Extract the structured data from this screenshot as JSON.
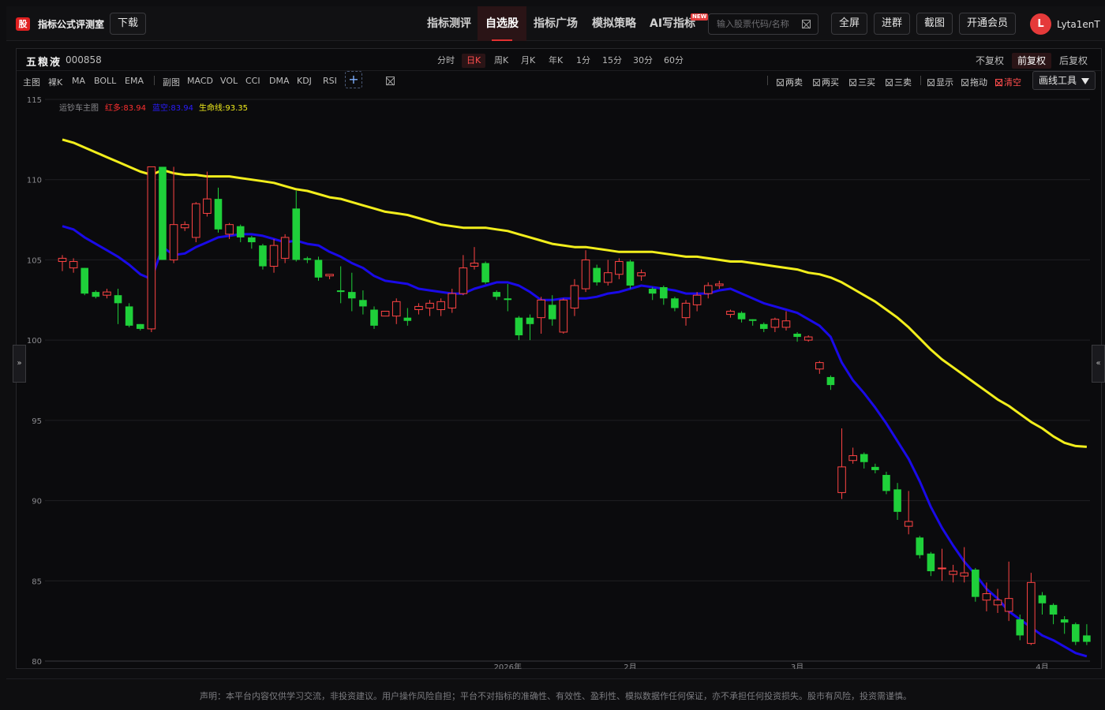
{
  "header": {
    "logo": "股",
    "app_title": "指标公式评测室",
    "download": "下载",
    "nav": [
      {
        "label": "指标测评",
        "active": false
      },
      {
        "label": "自选股",
        "active": true
      },
      {
        "label": "指标广场",
        "active": false
      },
      {
        "label": "模拟策略",
        "active": false
      },
      {
        "label": "AI写指标",
        "active": false
      }
    ],
    "new_badge": "NEW",
    "search_placeholder": "输入股票代码/名称",
    "buttons": [
      "全屏",
      "进群",
      "截图",
      "开通会员"
    ],
    "avatar": "L",
    "username": "Lyta1enT"
  },
  "stock": {
    "name": "五粮液",
    "code": "000858"
  },
  "periods": [
    {
      "label": "分时",
      "active": false
    },
    {
      "label": "日K",
      "active": true
    },
    {
      "label": "周K",
      "active": false
    },
    {
      "label": "月K",
      "active": false
    },
    {
      "label": "年K",
      "active": false
    },
    {
      "label": "1分",
      "active": false
    },
    {
      "label": "15分",
      "active": false
    },
    {
      "label": "30分",
      "active": false
    },
    {
      "label": "60分",
      "active": false
    }
  ],
  "adjust": [
    {
      "label": "不复权",
      "active": false
    },
    {
      "label": "前复权",
      "active": true
    },
    {
      "label": "后复权",
      "active": false
    }
  ],
  "main_tools": [
    "主图",
    "裸K",
    "MA",
    "BOLL",
    "EMA"
  ],
  "sub_tools": [
    "副图",
    "MACD",
    "VOL",
    "CCI",
    "DMA",
    "KDJ",
    "RSI"
  ],
  "plus": "+",
  "signals": [
    {
      "label": "两卖",
      "red": false
    },
    {
      "label": "两买",
      "red": false
    },
    {
      "label": "三买",
      "red": false
    },
    {
      "label": "三卖",
      "red": false
    },
    {
      "label": "显示",
      "red": false
    },
    {
      "label": "拖动",
      "red": false
    },
    {
      "label": "清空",
      "red": true
    }
  ],
  "draw_tools": "画线工具",
  "side_left": "»",
  "side_right": "«",
  "legend": {
    "title": "运钞车主图",
    "red": "红多:83.94",
    "blue": "蓝空:83.94",
    "yellow": "生命线:93.35"
  },
  "colors": {
    "up": "#ff4444",
    "down": "#1fd03a",
    "yellow": "#f2ee1c",
    "blue": "#1a0ae8"
  },
  "footer": "声明：本平台内容仅供学习交流，非投资建议。用户操作风险自担；平台不对指标的准确性、有效性、盈利性、模拟数据作任何保证，亦不承担任何投资损失。股市有风险，投资需谨慎。",
  "chart_data": {
    "type": "candlestick",
    "ylim": [
      80,
      115
    ],
    "yticks": [
      80,
      85,
      90,
      95,
      100,
      105,
      110,
      115
    ],
    "xticks": [
      {
        "index": 40,
        "label": "2026年"
      },
      {
        "index": 51,
        "label": "2月"
      },
      {
        "index": 66,
        "label": "3月"
      },
      {
        "index": 88,
        "label": "4月"
      }
    ],
    "candles": [
      [
        104.9,
        105.1,
        104.5,
        105.3,
        104.3
      ],
      [
        104.5,
        104.9,
        104.4,
        105.1,
        104.2
      ],
      [
        104.5,
        102.9,
        102.9,
        104.5,
        102.8
      ],
      [
        103.0,
        102.7,
        102.7,
        103.1,
        102.6
      ],
      [
        102.8,
        103.0,
        102.7,
        103.2,
        102.6
      ],
      [
        102.8,
        102.3,
        102.2,
        103.2,
        101.0
      ],
      [
        102.1,
        100.9,
        100.9,
        102.3,
        100.8
      ],
      [
        101.0,
        100.7,
        100.7,
        101.0,
        100.6
      ],
      [
        100.7,
        110.8,
        100.7,
        110.8,
        100.5
      ],
      [
        110.8,
        105.0,
        105.0,
        110.8,
        105.0
      ],
      [
        105.0,
        107.2,
        105.0,
        110.8,
        104.8
      ],
      [
        107.0,
        107.2,
        106.9,
        107.4,
        106.8
      ],
      [
        106.4,
        108.5,
        106.3,
        108.6,
        106.1
      ],
      [
        107.9,
        108.8,
        107.8,
        110.5,
        107.7
      ],
      [
        108.8,
        106.9,
        106.9,
        109.5,
        106.7
      ],
      [
        106.6,
        107.2,
        106.5,
        107.3,
        106.3
      ],
      [
        107.1,
        106.4,
        106.3,
        107.2,
        106.1
      ],
      [
        106.4,
        106.1,
        105.9,
        106.5,
        105.7
      ],
      [
        105.9,
        104.6,
        104.5,
        106.0,
        104.4
      ],
      [
        104.6,
        105.9,
        104.3,
        106.3,
        104.2
      ],
      [
        105.1,
        106.4,
        104.9,
        106.6,
        104.8
      ],
      [
        108.2,
        105.0,
        105.0,
        109.3,
        104.9
      ],
      [
        105.1,
        105.0,
        104.8,
        105.2,
        104.8
      ],
      [
        105.0,
        103.9,
        103.9,
        105.2,
        103.7
      ],
      [
        104.0,
        104.1,
        103.9,
        104.1,
        103.8
      ],
      [
        103.1,
        103.0,
        102.6,
        104.6,
        102.3
      ],
      [
        103.0,
        102.6,
        102.5,
        104.2,
        101.8
      ],
      [
        102.5,
        102.1,
        101.7,
        103.1,
        101.6
      ],
      [
        101.9,
        100.9,
        100.8,
        102.1,
        100.7
      ],
      [
        101.5,
        101.8,
        101.5,
        101.7,
        101.5
      ],
      [
        101.5,
        102.4,
        101.2,
        102.6,
        101.0
      ],
      [
        101.4,
        101.2,
        101.0,
        102.0,
        100.9
      ],
      [
        101.9,
        102.1,
        101.7,
        102.3,
        101.6
      ],
      [
        102.0,
        102.3,
        101.8,
        102.5,
        101.5
      ],
      [
        101.9,
        102.4,
        101.7,
        102.6,
        101.5
      ],
      [
        102.0,
        102.9,
        101.8,
        103.2,
        101.7
      ],
      [
        102.9,
        104.5,
        102.8,
        105.3,
        102.8
      ],
      [
        104.6,
        104.8,
        104.6,
        105.8,
        104.4
      ],
      [
        104.8,
        103.6,
        103.6,
        104.9,
        103.5
      ],
      [
        103.0,
        102.7,
        102.6,
        103.1,
        102.5
      ],
      [
        102.6,
        102.5,
        102.4,
        103.5,
        101.8
      ],
      [
        101.4,
        100.3,
        100.2,
        101.5,
        100.0
      ],
      [
        101.4,
        101.0,
        100.4,
        101.6,
        100.0
      ],
      [
        101.4,
        102.5,
        101.2,
        102.7,
        100.4
      ],
      [
        102.2,
        101.3,
        101.2,
        102.8,
        100.9
      ],
      [
        100.5,
        102.5,
        100.4,
        102.6,
        100.4
      ],
      [
        102.0,
        103.4,
        101.6,
        103.8,
        101.5
      ],
      [
        103.2,
        105.0,
        103.1,
        105.6,
        103.0
      ],
      [
        104.5,
        103.6,
        103.4,
        104.7,
        103.4
      ],
      [
        103.6,
        104.2,
        103.5,
        105.0,
        103.4
      ],
      [
        104.1,
        104.9,
        103.9,
        105.1,
        103.8
      ],
      [
        104.9,
        103.4,
        103.4,
        105.0,
        103.2
      ],
      [
        104.0,
        104.2,
        103.8,
        104.4,
        103.7
      ],
      [
        103.2,
        102.9,
        102.8,
        103.3,
        102.5
      ],
      [
        103.3,
        102.6,
        102.5,
        103.4,
        102.2
      ],
      [
        102.6,
        102.0,
        101.9,
        102.7,
        101.8
      ],
      [
        101.4,
        102.3,
        101.0,
        102.5,
        100.9
      ],
      [
        102.2,
        102.8,
        102.0,
        103.0,
        101.8
      ],
      [
        102.9,
        103.4,
        102.7,
        103.6,
        102.6
      ],
      [
        103.4,
        103.5,
        103.3,
        103.7,
        103.2
      ],
      [
        101.6,
        101.8,
        101.5,
        101.9,
        101.4
      ],
      [
        101.7,
        101.3,
        101.2,
        101.8,
        101.1
      ],
      [
        101.3,
        101.2,
        101.1,
        101.3,
        100.9
      ],
      [
        101.0,
        100.7,
        100.6,
        101.1,
        100.5
      ],
      [
        100.8,
        101.3,
        100.6,
        101.4,
        100.5
      ],
      [
        100.8,
        101.2,
        100.7,
        101.8,
        100.6
      ],
      [
        100.4,
        100.2,
        100.0,
        100.5,
        99.9
      ],
      [
        100.0,
        100.2,
        100.0,
        100.3,
        99.9
      ],
      [
        98.2,
        98.6,
        98.1,
        98.7,
        97.9
      ],
      [
        97.7,
        97.2,
        97.1,
        97.8,
        96.9
      ],
      [
        90.5,
        92.1,
        90.1,
        94.5,
        90.1
      ],
      [
        92.5,
        92.8,
        92.4,
        93.3,
        92.3
      ],
      [
        92.9,
        92.4,
        92.3,
        93.0,
        92.0
      ],
      [
        92.1,
        91.9,
        91.9,
        92.3,
        91.7
      ],
      [
        91.6,
        90.6,
        90.5,
        91.8,
        90.4
      ],
      [
        90.7,
        89.3,
        89.0,
        91.1,
        88.8
      ],
      [
        88.4,
        88.7,
        88.2,
        90.6,
        87.9
      ],
      [
        87.7,
        86.6,
        86.5,
        87.8,
        86.4
      ],
      [
        86.7,
        85.6,
        85.4,
        86.8,
        85.3
      ],
      [
        85.8,
        85.8,
        85.3,
        87.0,
        85.0
      ],
      [
        85.4,
        85.6,
        85.2,
        86.0,
        84.9
      ],
      [
        85.3,
        85.5,
        85.1,
        87.1,
        84.9
      ],
      [
        85.7,
        84.0,
        83.9,
        85.8,
        83.7
      ],
      [
        83.8,
        84.2,
        83.5,
        84.9,
        83.1
      ],
      [
        83.5,
        83.8,
        83.3,
        84.5,
        83.0
      ],
      [
        83.1,
        83.9,
        83.1,
        86.2,
        82.5
      ],
      [
        82.6,
        81.6,
        81.5,
        82.9,
        81.3
      ],
      [
        81.1,
        84.9,
        81.0,
        85.5,
        81.0
      ],
      [
        84.1,
        83.6,
        83.5,
        84.3,
        82.9
      ],
      [
        83.5,
        82.9,
        82.8,
        83.6,
        82.3
      ],
      [
        82.6,
        82.4,
        82.2,
        82.8,
        81.7
      ],
      [
        82.3,
        81.2,
        81.1,
        82.4,
        81.0
      ],
      [
        81.6,
        81.2,
        81.1,
        82.3,
        81.0
      ]
    ],
    "series": [
      {
        "name": "生命线",
        "color": "yellow",
        "values": [
          112.5,
          112.3,
          112.0,
          111.7,
          111.4,
          111.1,
          110.8,
          110.5,
          110.3,
          110.6,
          110.4,
          110.3,
          110.3,
          110.2,
          110.2,
          110.2,
          110.1,
          110.0,
          109.9,
          109.8,
          109.6,
          109.4,
          109.3,
          109.1,
          108.9,
          108.8,
          108.6,
          108.4,
          108.2,
          108.0,
          107.9,
          107.8,
          107.6,
          107.4,
          107.2,
          107.1,
          107.0,
          107.0,
          107.0,
          106.9,
          106.8,
          106.6,
          106.4,
          106.2,
          106.0,
          105.9,
          105.8,
          105.8,
          105.7,
          105.6,
          105.5,
          105.5,
          105.5,
          105.5,
          105.4,
          105.3,
          105.2,
          105.2,
          105.1,
          105.0,
          104.9,
          104.9,
          104.8,
          104.7,
          104.6,
          104.5,
          104.4,
          104.2,
          104.1,
          103.9,
          103.6,
          103.2,
          102.8,
          102.4,
          101.9,
          101.4,
          100.8,
          100.1,
          99.4,
          98.8,
          98.3,
          97.8,
          97.3,
          96.8,
          96.3,
          95.9,
          95.4,
          94.9,
          94.5,
          94.0,
          93.6,
          93.4,
          93.35
        ]
      },
      {
        "name": "蓝空",
        "color": "blue",
        "values": [
          107.1,
          106.9,
          106.4,
          106.0,
          105.6,
          105.2,
          104.7,
          104.1,
          103.8,
          105.8,
          105.3,
          105.4,
          105.8,
          106.1,
          106.4,
          106.5,
          106.6,
          106.6,
          106.5,
          106.3,
          106.1,
          106.2,
          106.0,
          105.9,
          105.5,
          105.2,
          104.8,
          104.5,
          104.0,
          103.7,
          103.6,
          103.5,
          103.2,
          103.1,
          103.0,
          102.9,
          102.9,
          103.2,
          103.4,
          103.6,
          103.6,
          103.4,
          103.0,
          102.5,
          102.5,
          102.6,
          102.6,
          102.6,
          102.7,
          102.9,
          103.0,
          103.2,
          103.4,
          103.3,
          103.2,
          103.1,
          102.9,
          102.9,
          102.9,
          103.1,
          103.2,
          102.9,
          102.6,
          102.3,
          102.1,
          101.9,
          101.7,
          101.3,
          100.9,
          100.2,
          98.6,
          97.5,
          96.7,
          95.8,
          94.8,
          93.7,
          92.6,
          91.2,
          89.6,
          88.3,
          87.2,
          86.2,
          85.4,
          84.5,
          83.9,
          83.1,
          82.6,
          82.1,
          81.6,
          81.3,
          80.9,
          80.5,
          80.3
        ]
      }
    ]
  }
}
